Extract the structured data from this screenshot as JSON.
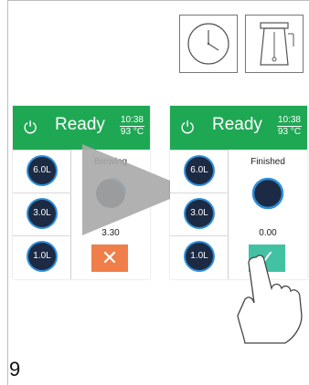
{
  "top_icons": [
    {
      "name": "clock-icon"
    },
    {
      "name": "coffee-brewer-icon"
    }
  ],
  "left_panel": {
    "power_icon": "⏻",
    "status": "Ready",
    "time": "10:38",
    "temp": "93 °C",
    "sizes": [
      "6.0L",
      "3.0L",
      "1.0L"
    ],
    "state_label": "Brewing",
    "amount": "3.30",
    "action": "✕"
  },
  "right_panel": {
    "power_icon": "⏻",
    "status": "Ready",
    "time": "10:38",
    "temp": "93 °C",
    "sizes": [
      "6.0L",
      "3.0L",
      "1.0L"
    ],
    "state_label": "Finished",
    "amount": "0.00",
    "action": "✓"
  },
  "page_number": "9",
  "colors": {
    "header": "#1fa854",
    "cancel": "#ef7e4a",
    "ok": "#42c2a3",
    "ring": "#2f8fd8",
    "cup_fill": "#1c2a44"
  }
}
